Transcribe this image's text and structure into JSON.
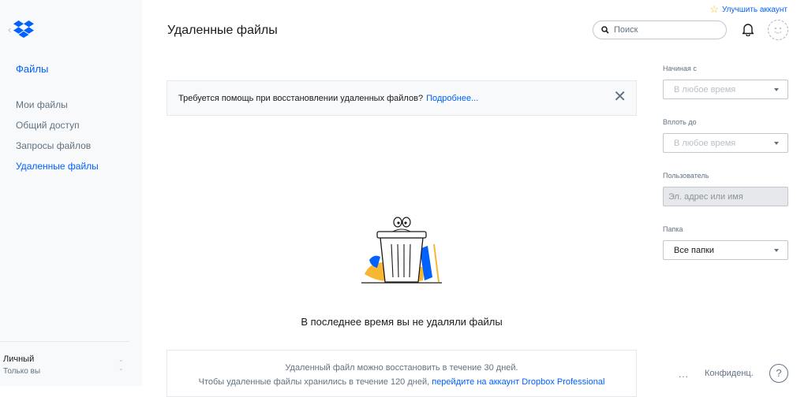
{
  "sidebar": {
    "back_glyph": "‹",
    "section_title": "Файлы",
    "items": [
      {
        "label": "Мои файлы",
        "active": false
      },
      {
        "label": "Общий доступ",
        "active": false
      },
      {
        "label": "Запросы файлов",
        "active": false
      },
      {
        "label": "Удаленные файлы",
        "active": true
      }
    ],
    "account": {
      "name": "Личный",
      "subtitle": "Только вы"
    }
  },
  "header": {
    "upgrade_label": "Улучшить аккаунт",
    "title": "Удаленные файлы",
    "search_placeholder": "Поиск"
  },
  "banner": {
    "text": "Требуется помощь при восстановлении удаленных файлов?",
    "link": "Подробнее...",
    "close_glyph": "✕"
  },
  "empty_state": {
    "message": "В последнее время вы не удаляли файлы"
  },
  "info_box": {
    "line1": "Удаленный файл можно восстановить в течение 30 дней.",
    "line2_text": "Чтобы удаленные файлы хранились в течение 120 дней,",
    "line2_link": "перейдите на аккаунт Dropbox Professional"
  },
  "filters": {
    "from": {
      "label": "Начиная с",
      "value": "В любое время"
    },
    "to": {
      "label": "Вплоть до",
      "value": "В любое время"
    },
    "user": {
      "label": "Пользователь",
      "placeholder": "Эл. адрес или имя"
    },
    "folder": {
      "label": "Папка",
      "value": "Все папки"
    }
  },
  "footer": {
    "more": "...",
    "privacy": "Конфиденц.",
    "help": "?"
  },
  "colors": {
    "accent": "#0061fe",
    "sidebar_bg": "#f7f9fa",
    "muted_text": "#637282"
  }
}
